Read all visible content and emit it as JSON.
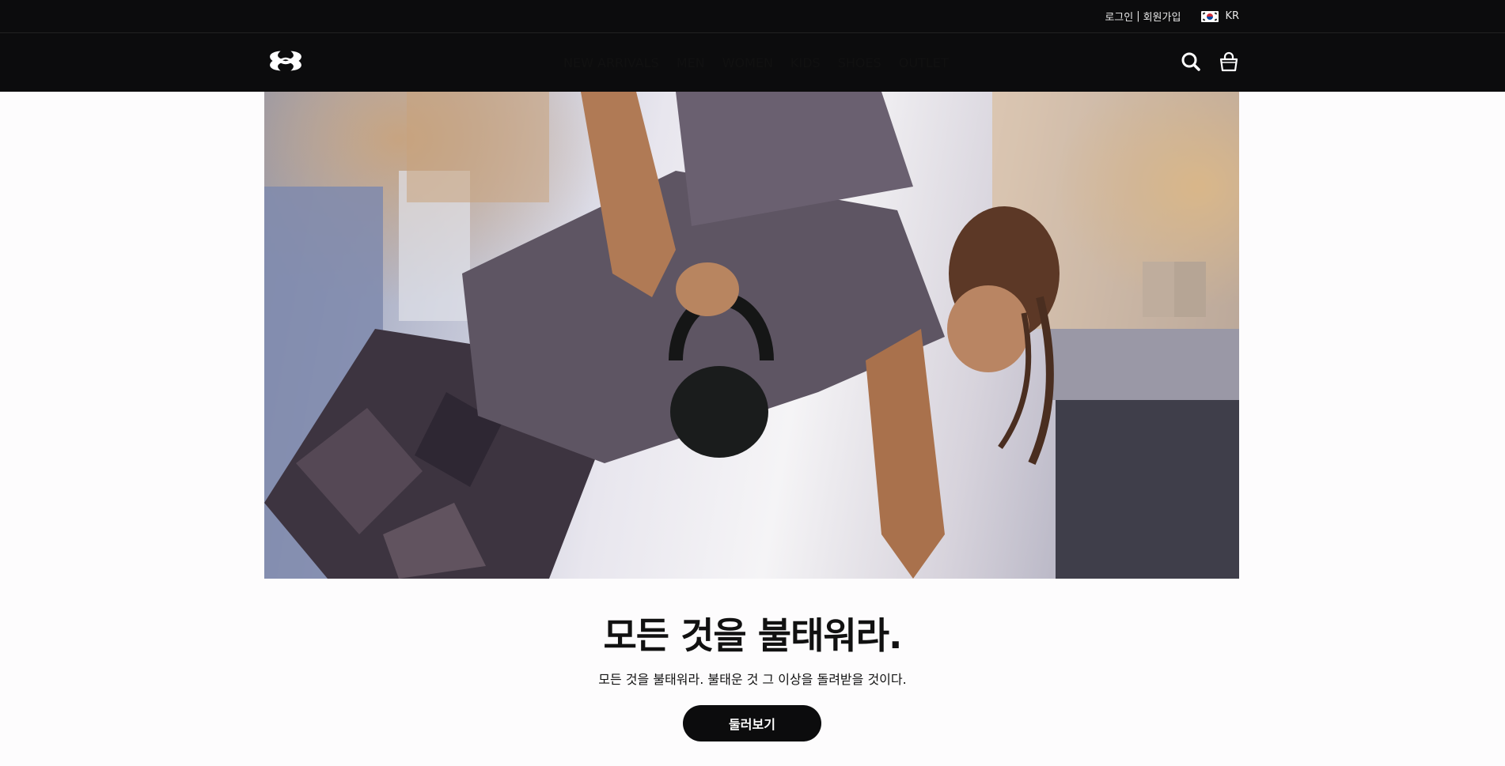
{
  "topbar": {
    "login": "로그인",
    "separator": "|",
    "signup": "회원가입",
    "region": "KR"
  },
  "nav": {
    "items": [
      "NEW ARRIVALS",
      "MEN",
      "WOMEN",
      "KIDS",
      "SHOES",
      "OUTLET"
    ]
  },
  "icons": {
    "logo": "under-armour-logo",
    "search": "search-icon",
    "cart": "shopping-bag-icon",
    "flag": "korea-flag-icon"
  },
  "hero": {
    "headline": "모든 것을 불태워라.",
    "subtext": "모든 것을 불태워라. 불태운 것 그 이상을 돌려받을 것이다.",
    "button": "둘러보기"
  },
  "colors": {
    "header_bg": "#0c0c0d",
    "page_bg": "#fdfcfd",
    "button_bg": "#0c0c0d"
  }
}
